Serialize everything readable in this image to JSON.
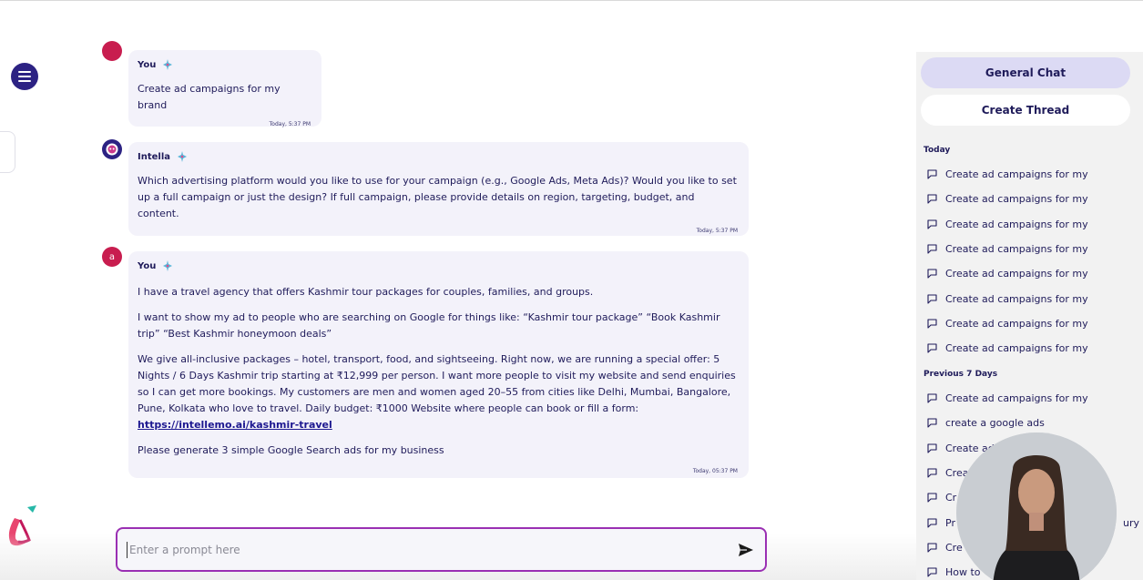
{
  "messages": [
    {
      "sender": "You",
      "text": "Create ad campaigns for my brand",
      "timestamp": "Today, 5:37 PM"
    },
    {
      "sender": "Intella",
      "text": "Which advertising platform would you like to use for your campaign (e.g., Google Ads, Meta Ads)? Would you like to set up a full campaign or just the design? If full campaign, please provide details on region, targeting, budget, and content.",
      "timestamp": "Today, 5:37 PM"
    },
    {
      "sender": "You",
      "avatar_letter": "a",
      "paragraphs": [
        "I have a travel agency that offers Kashmir tour packages for couples, families, and groups.",
        "I want to show my ad to people who are searching on Google for things like: “Kashmir tour package” “Book Kashmir trip” “Best Kashmir honeymoon deals”",
        "We give all-inclusive packages – hotel, transport, food, and sightseeing. Right now, we are running a special offer: 5 Nights / 6 Days Kashmir trip starting at ₹12,999 per person. I want more people to visit my website and send enquiries so I can get more bookings. My customers are men and women aged 20–55 from cities like Delhi, Mumbai, Bangalore, Pune, Kolkata who love to travel. Daily budget: ₹1000 Website where people can book or fill a form:"
      ],
      "link": "https://intellemo.ai/kashmir-travel",
      "final_paragraph": "Please generate 3 simple Google Search ads for my business",
      "timestamp": "Today, 05:37 PM"
    }
  ],
  "prompt": {
    "placeholder": "Enter a prompt here",
    "value": ""
  },
  "sidebar": {
    "general_chat_label": "General Chat",
    "create_thread_label": "Create Thread",
    "today_heading": "Today",
    "today_items": [
      "Create ad campaigns for my",
      "Create ad campaigns for my",
      "Create ad campaigns for my",
      "Create ad campaigns for my",
      "Create ad campaigns for my",
      "Create ad campaigns for my",
      "Create ad campaigns for my",
      "Create ad campaigns for my"
    ],
    "previous_heading": "Previous 7 Days",
    "previous_items": [
      "Create ad campaigns for my",
      "create a google ads",
      "Create ad",
      "Crea",
      "Cr",
      "Pr",
      "Cre",
      "How to"
    ],
    "partial_right_text": "ury"
  },
  "colors": {
    "primary": "#2c2283",
    "user_avatar": "#c81d4f",
    "bubble_bg": "#f3f2fa",
    "prompt_border": "#9a2fb3",
    "sidebar_bg": "#f2f2f2",
    "general_chat_bg": "#dcdaf4"
  },
  "icons": {
    "menu": "hamburger-icon",
    "send": "send-arrow-icon",
    "thread": "chat-bubble-icon",
    "sender_badge": "sparkle-icon"
  }
}
